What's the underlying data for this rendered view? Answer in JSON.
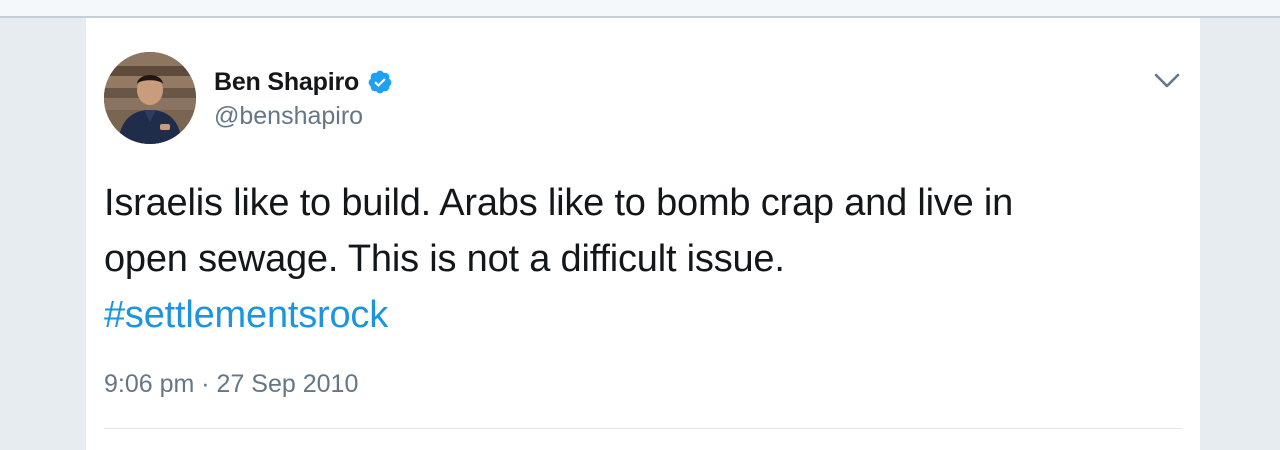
{
  "tweet": {
    "author": {
      "name": "Ben Shapiro",
      "handle": "@benshapiro",
      "verified": true
    },
    "text_line1": "Israelis like to build. Arabs like to bomb crap and live in",
    "text_line2": "open sewage. This is not a difficult issue.",
    "hashtag": "#settlementsrock",
    "timestamp": "9:06 pm · 27 Sep 2010"
  },
  "icons": {
    "verified": "verified-badge-icon",
    "caret": "chevron-down-icon"
  },
  "colors": {
    "text": "#14171a",
    "muted": "#657786",
    "link": "#1b95e0",
    "verified": "#1da1f2",
    "background": "#e6ecf0"
  }
}
